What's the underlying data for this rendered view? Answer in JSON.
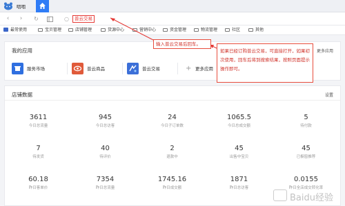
{
  "app": {
    "name": "咽咽"
  },
  "address": {
    "text": "普云交易"
  },
  "bookmarks": [
    "最常使用",
    "宝贝管理",
    "店铺管理",
    "货源中心",
    "营销中心",
    "资金管理",
    "物流管理",
    "社区",
    "其他"
  ],
  "my_apps": {
    "title": "我的应用",
    "more": "更多应用",
    "items": [
      "服务市场",
      "普云商品",
      "普云交易",
      "更多应用"
    ]
  },
  "shop_data": {
    "title": "店铺数据",
    "settings": "设置",
    "rows": [
      [
        {
          "value": "3611",
          "label": "今日总流量"
        },
        {
          "value": "945",
          "label": "今日总访客"
        },
        {
          "value": "24",
          "label": "今日子订单数"
        },
        {
          "value": "1065.5",
          "label": "今日总成交额"
        },
        {
          "value": "5",
          "label": "待付款"
        }
      ],
      [
        {
          "value": "7",
          "label": "待发货"
        },
        {
          "value": "40",
          "label": "待评价"
        },
        {
          "value": "2",
          "label": "退款中"
        },
        {
          "value": "45",
          "label": "出售中宝贝"
        },
        {
          "value": "45",
          "label": "已橱窗推荐"
        }
      ],
      [
        {
          "value": "60.18",
          "label": "昨日客单价"
        },
        {
          "value": "7354",
          "label": "昨日总流量"
        },
        {
          "value": "1745.16",
          "label": "昨日成交额"
        },
        {
          "value": "1871",
          "label": "昨日总访客"
        },
        {
          "value": "0.0155",
          "label": "昨日全店成交转化率"
        }
      ]
    ]
  },
  "annotations": {
    "input_note": "输入普云交易后回车。",
    "info_note": "如果已经订购普云交易，可直接打开，如果初次使用，回车后将到搜索结果，按照页面提示操作即可。"
  },
  "watermark": {
    "text": "Baidu经验"
  },
  "colors": {
    "accent": "#2f7cf6",
    "annotation": "#e53935"
  }
}
